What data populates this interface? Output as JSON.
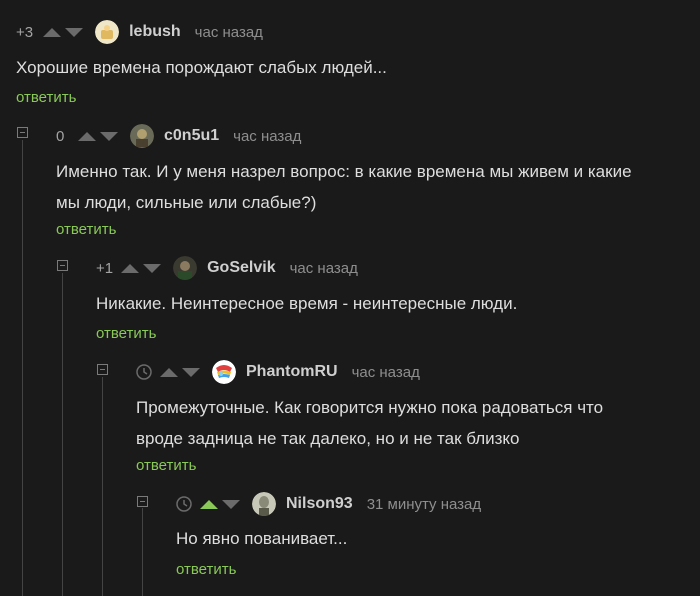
{
  "reply_label": "ответить",
  "accent": "#8ac858",
  "comments": [
    {
      "rating": "+3",
      "author": "lebush",
      "time": "час назад",
      "text": [
        "Хорошие времена порождают слабых людей..."
      ]
    },
    {
      "rating": "0",
      "author": "c0n5u1",
      "time": "час назад",
      "text": [
        "Именно так. И у меня назрел вопрос: в какие времена мы живем и какие",
        "мы люди, сильные или слабые?)"
      ]
    },
    {
      "rating": "+1",
      "author": "GoSelvik",
      "time": "час назад",
      "text": [
        "Никакие. Неинтересное время - неинтересные люди."
      ]
    },
    {
      "rating": "",
      "author": "PhantomRU",
      "time": "час назад",
      "text": [
        "Промежуточные. Как говорится нужно пока радоваться что",
        "вроде задница не так далеко, но и не так близко"
      ]
    },
    {
      "rating": "",
      "author": "Nilson93",
      "time": "31 минуту назад",
      "text": [
        "Но явно пованивает..."
      ]
    }
  ]
}
